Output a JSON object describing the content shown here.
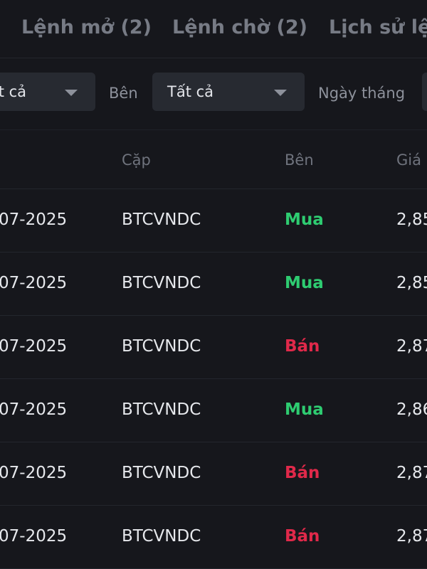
{
  "tabs": [
    {
      "label": "Lệnh mở (2)"
    },
    {
      "label": "Lệnh chờ (2)"
    },
    {
      "label": "Lịch sử lệnh"
    }
  ],
  "filters": {
    "pair_value": "Tất cả",
    "side_label": "Bên",
    "side_value": "Tất cả",
    "date_label": "Ngày tháng"
  },
  "table": {
    "headers": {
      "pair": "Cặp",
      "side": "Bên",
      "price": "Giá"
    },
    "rows": [
      {
        "date": "07-2025",
        "pair": "BTCVNDC",
        "side": "Mua",
        "side_type": "buy",
        "price": "2,85"
      },
      {
        "date": "07-2025",
        "pair": "BTCVNDC",
        "side": "Mua",
        "side_type": "buy",
        "price": "2,85"
      },
      {
        "date": "07-2025",
        "pair": "BTCVNDC",
        "side": "Bán",
        "side_type": "sell",
        "price": "2,87"
      },
      {
        "date": "07-2025",
        "pair": "BTCVNDC",
        "side": "Mua",
        "side_type": "buy",
        "price": "2,86"
      },
      {
        "date": "07-2025",
        "pair": "BTCVNDC",
        "side": "Bán",
        "side_type": "sell",
        "price": "2,87"
      },
      {
        "date": "07-2025",
        "pair": "BTCVNDC",
        "side": "Bán",
        "side_type": "sell",
        "price": "2,87"
      }
    ]
  },
  "colors": {
    "background": "#16171c",
    "buy": "#2ecc71",
    "sell": "#e0294a"
  }
}
